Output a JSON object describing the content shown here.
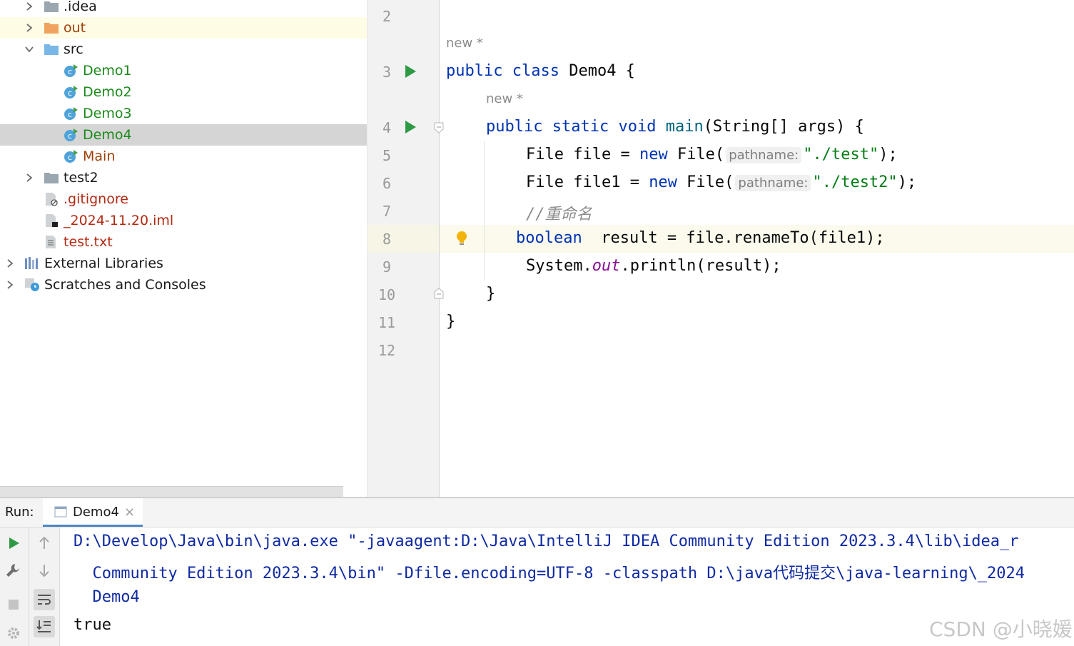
{
  "project_tree": {
    "items": [
      {
        "label": ".idea",
        "icon": "folder-icon"
      },
      {
        "label": "out",
        "icon": "folder-orange-icon"
      },
      {
        "label": "src",
        "icon": "folder-blue-icon"
      },
      {
        "label": "Demo1",
        "icon": "java-class-icon"
      },
      {
        "label": "Demo2",
        "icon": "java-class-icon"
      },
      {
        "label": "Demo3",
        "icon": "java-class-icon"
      },
      {
        "label": "Demo4",
        "icon": "java-class-icon"
      },
      {
        "label": "Main",
        "icon": "java-class-icon"
      },
      {
        "label": "test2",
        "icon": "folder-icon"
      },
      {
        "label": ".gitignore",
        "icon": "gitignore-file-icon"
      },
      {
        "label": "_2024-11.20.iml",
        "icon": "iml-file-icon"
      },
      {
        "label": "test.txt",
        "icon": "text-file-icon"
      },
      {
        "label": "External Libraries",
        "icon": "library-icon"
      },
      {
        "label": "Scratches and Consoles",
        "icon": "scratches-icon"
      }
    ]
  },
  "editor": {
    "line_numbers": [
      "2",
      "3",
      "4",
      "5",
      "6",
      "7",
      "8",
      "9",
      "10",
      "11",
      "12"
    ],
    "lens_hints": [
      "new *",
      "new *"
    ],
    "param_hint": "pathname:",
    "code": {
      "l3_kw1": "public",
      "l3_kw2": "class",
      "l3_rest": " Demo4 {",
      "l4_kw1": "public",
      "l4_kw2": "static",
      "l4_kw3": "void",
      "l4_fn": "main",
      "l4_rest": "(String[] args) {",
      "l5_a": "File file = ",
      "l5_kw": "new",
      "l5_b": " File(",
      "l5_str": "\"./test\"",
      "l5_c": ");",
      "l6_a": "File file1 = ",
      "l6_kw": "new",
      "l6_b": " File(",
      "l6_str": "\"./test2\"",
      "l6_c": ");",
      "l7_cmt": "//重命名",
      "l8_kw": "boolean",
      "l8_rest": "  result = file.renameTo(file1);",
      "l9_a": "System.",
      "l9_fld": "out",
      "l9_b": ".println(result);",
      "l10": "}",
      "l11": "}"
    }
  },
  "run_panel": {
    "label": "Run:",
    "tab_label": "Demo4",
    "tab_close": "×",
    "console_lines": [
      "D:\\Develop\\Java\\bin\\java.exe \"-javaagent:D:\\Java\\IntelliJ IDEA Community Edition 2023.3.4\\lib\\idea_r",
      "  Community Edition 2023.3.4\\bin\" -Dfile.encoding=UTF-8 -classpath D:\\java代码提交\\java-learning\\_2024",
      "  Demo4",
      "true"
    ]
  },
  "watermark": "CSDN @小晓媛",
  "colors": {
    "keyword": "#0033b3",
    "string": "#067d17",
    "field": "#871094",
    "comment": "#8c8c8c",
    "method_decl": "#00627a",
    "run_green": "#2e9a44",
    "console_blue": "#0f2aa3",
    "selected_row": "#d5d5d5",
    "highlight_row": "#fefce5"
  }
}
